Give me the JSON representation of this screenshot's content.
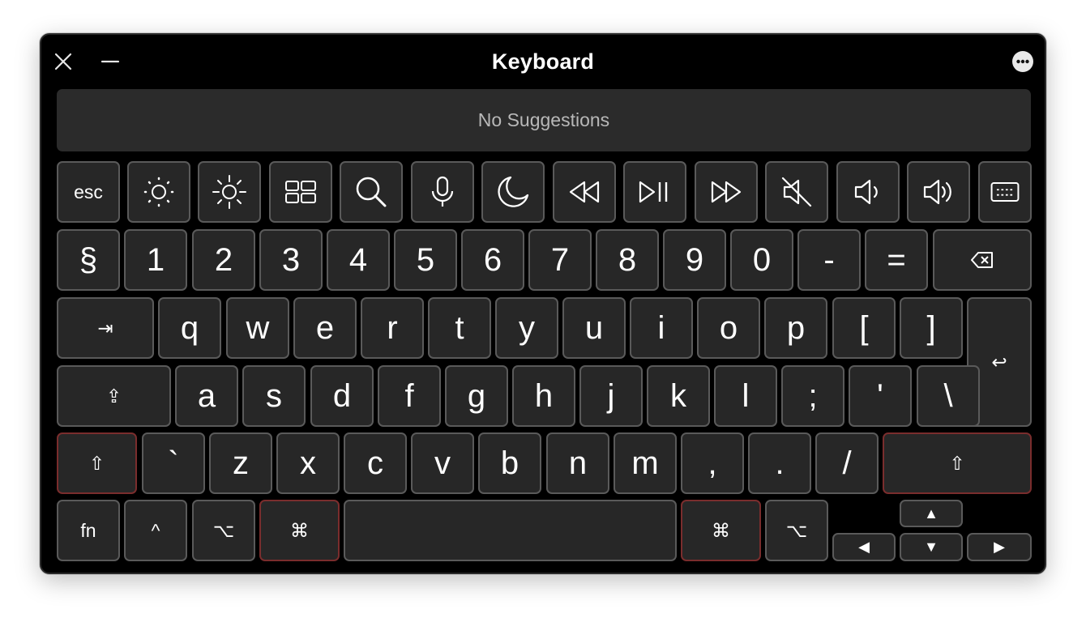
{
  "window": {
    "title": "Keyboard",
    "suggestions_text": "No Suggestions"
  },
  "function_row": {
    "esc": "esc",
    "keys": [
      {
        "name": "brightness-down-icon"
      },
      {
        "name": "brightness-up-icon"
      },
      {
        "name": "mission-control-icon"
      },
      {
        "name": "spotlight-search-icon"
      },
      {
        "name": "dictation-icon"
      },
      {
        "name": "do-not-disturb-icon"
      },
      {
        "name": "rewind-icon"
      },
      {
        "name": "play-pause-icon"
      },
      {
        "name": "fast-forward-icon"
      },
      {
        "name": "mute-icon"
      },
      {
        "name": "volume-down-icon"
      },
      {
        "name": "volume-up-icon"
      },
      {
        "name": "lock-screen-icon"
      }
    ]
  },
  "number_row": [
    "§",
    "1",
    "2",
    "3",
    "4",
    "5",
    "6",
    "7",
    "8",
    "9",
    "0",
    "-",
    "="
  ],
  "qwerty_row": [
    "q",
    "w",
    "e",
    "r",
    "t",
    "y",
    "u",
    "i",
    "o",
    "p",
    "[",
    "]"
  ],
  "home_row": [
    "a",
    "s",
    "d",
    "f",
    "g",
    "h",
    "j",
    "k",
    "l",
    ";",
    "'",
    "\\"
  ],
  "bottom_letter_row": [
    "`",
    "z",
    "x",
    "c",
    "v",
    "b",
    "n",
    "m",
    ",",
    ".",
    "/"
  ],
  "modifiers": {
    "tab": "⇥",
    "caps_lock": "⇪",
    "left_shift": "⇧",
    "right_shift": "⇧",
    "delete": "⌫",
    "return": "↩",
    "fn": "fn",
    "control": "^",
    "left_option": "⌥",
    "left_command": "⌘",
    "right_command": "⌘",
    "right_option": "⌥"
  },
  "arrows": {
    "up": "▲",
    "left": "◀",
    "down": "▼",
    "right": "▶"
  },
  "colors": {
    "window_bg": "#000000",
    "key_bg": "#272727",
    "key_border": "#5a5a5a",
    "sticky_modifier_border": "#7a2d2d"
  }
}
